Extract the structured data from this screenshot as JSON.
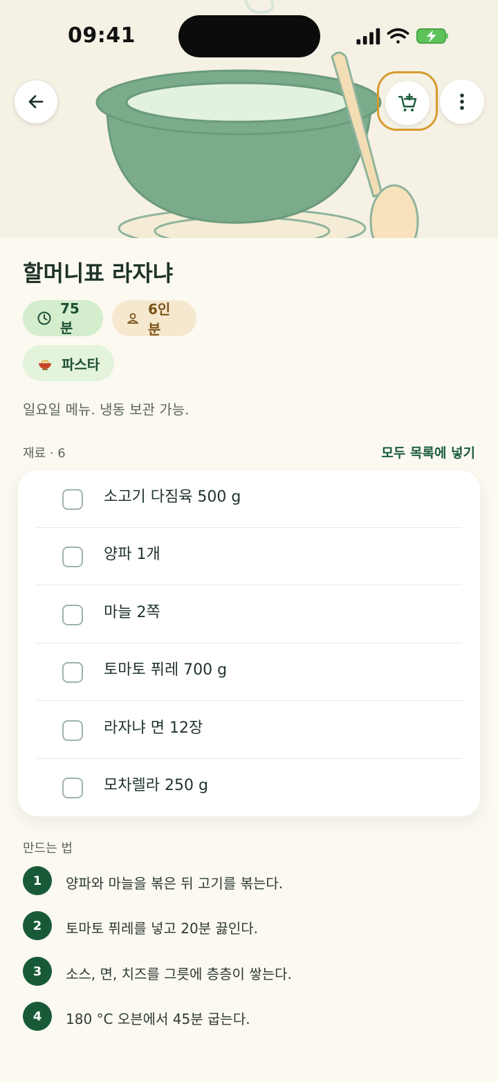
{
  "status_bar": {
    "time": "09:41"
  },
  "recipe": {
    "title": "할머니표 라자냐",
    "chips": {
      "time": "75분",
      "servings": "6인분",
      "category": "파스타"
    },
    "description": "일요일 메뉴. 냉동 보관 가능."
  },
  "ingredients": {
    "label": "재료 · 6",
    "add_all_label": "모두 목록에 넣기",
    "items": [
      {
        "label": "소고기 다짐육 500 g"
      },
      {
        "label": "양파 1개"
      },
      {
        "label": "마늘 2쪽"
      },
      {
        "label": "토마토 퓌레 700 g"
      },
      {
        "label": "라자냐 면 12장"
      },
      {
        "label": "모차렐라 250 g"
      }
    ]
  },
  "steps": {
    "label": "만드는 법",
    "items": [
      {
        "num": "1",
        "text": "양파와 마늘을 볶은 뒤 고기를 볶는다."
      },
      {
        "num": "2",
        "text": "토마토 퓌레를 넣고 20분 끓인다."
      },
      {
        "num": "3",
        "text": "소스, 면, 치즈를 그릇에 층층이 쌓는다."
      },
      {
        "num": "4",
        "text": "180 °C 오븐에서 45분 굽는다."
      }
    ]
  },
  "colors": {
    "accent": "#185a38",
    "highlight": "#d79a2e",
    "background": "#fbf9f0"
  },
  "icons": {
    "back": "arrow-left-icon",
    "cart": "cart-plus-icon",
    "more": "more-vertical-icon",
    "time": "clock-icon",
    "servings": "person-icon",
    "category": "pasta-bowl-icon"
  }
}
